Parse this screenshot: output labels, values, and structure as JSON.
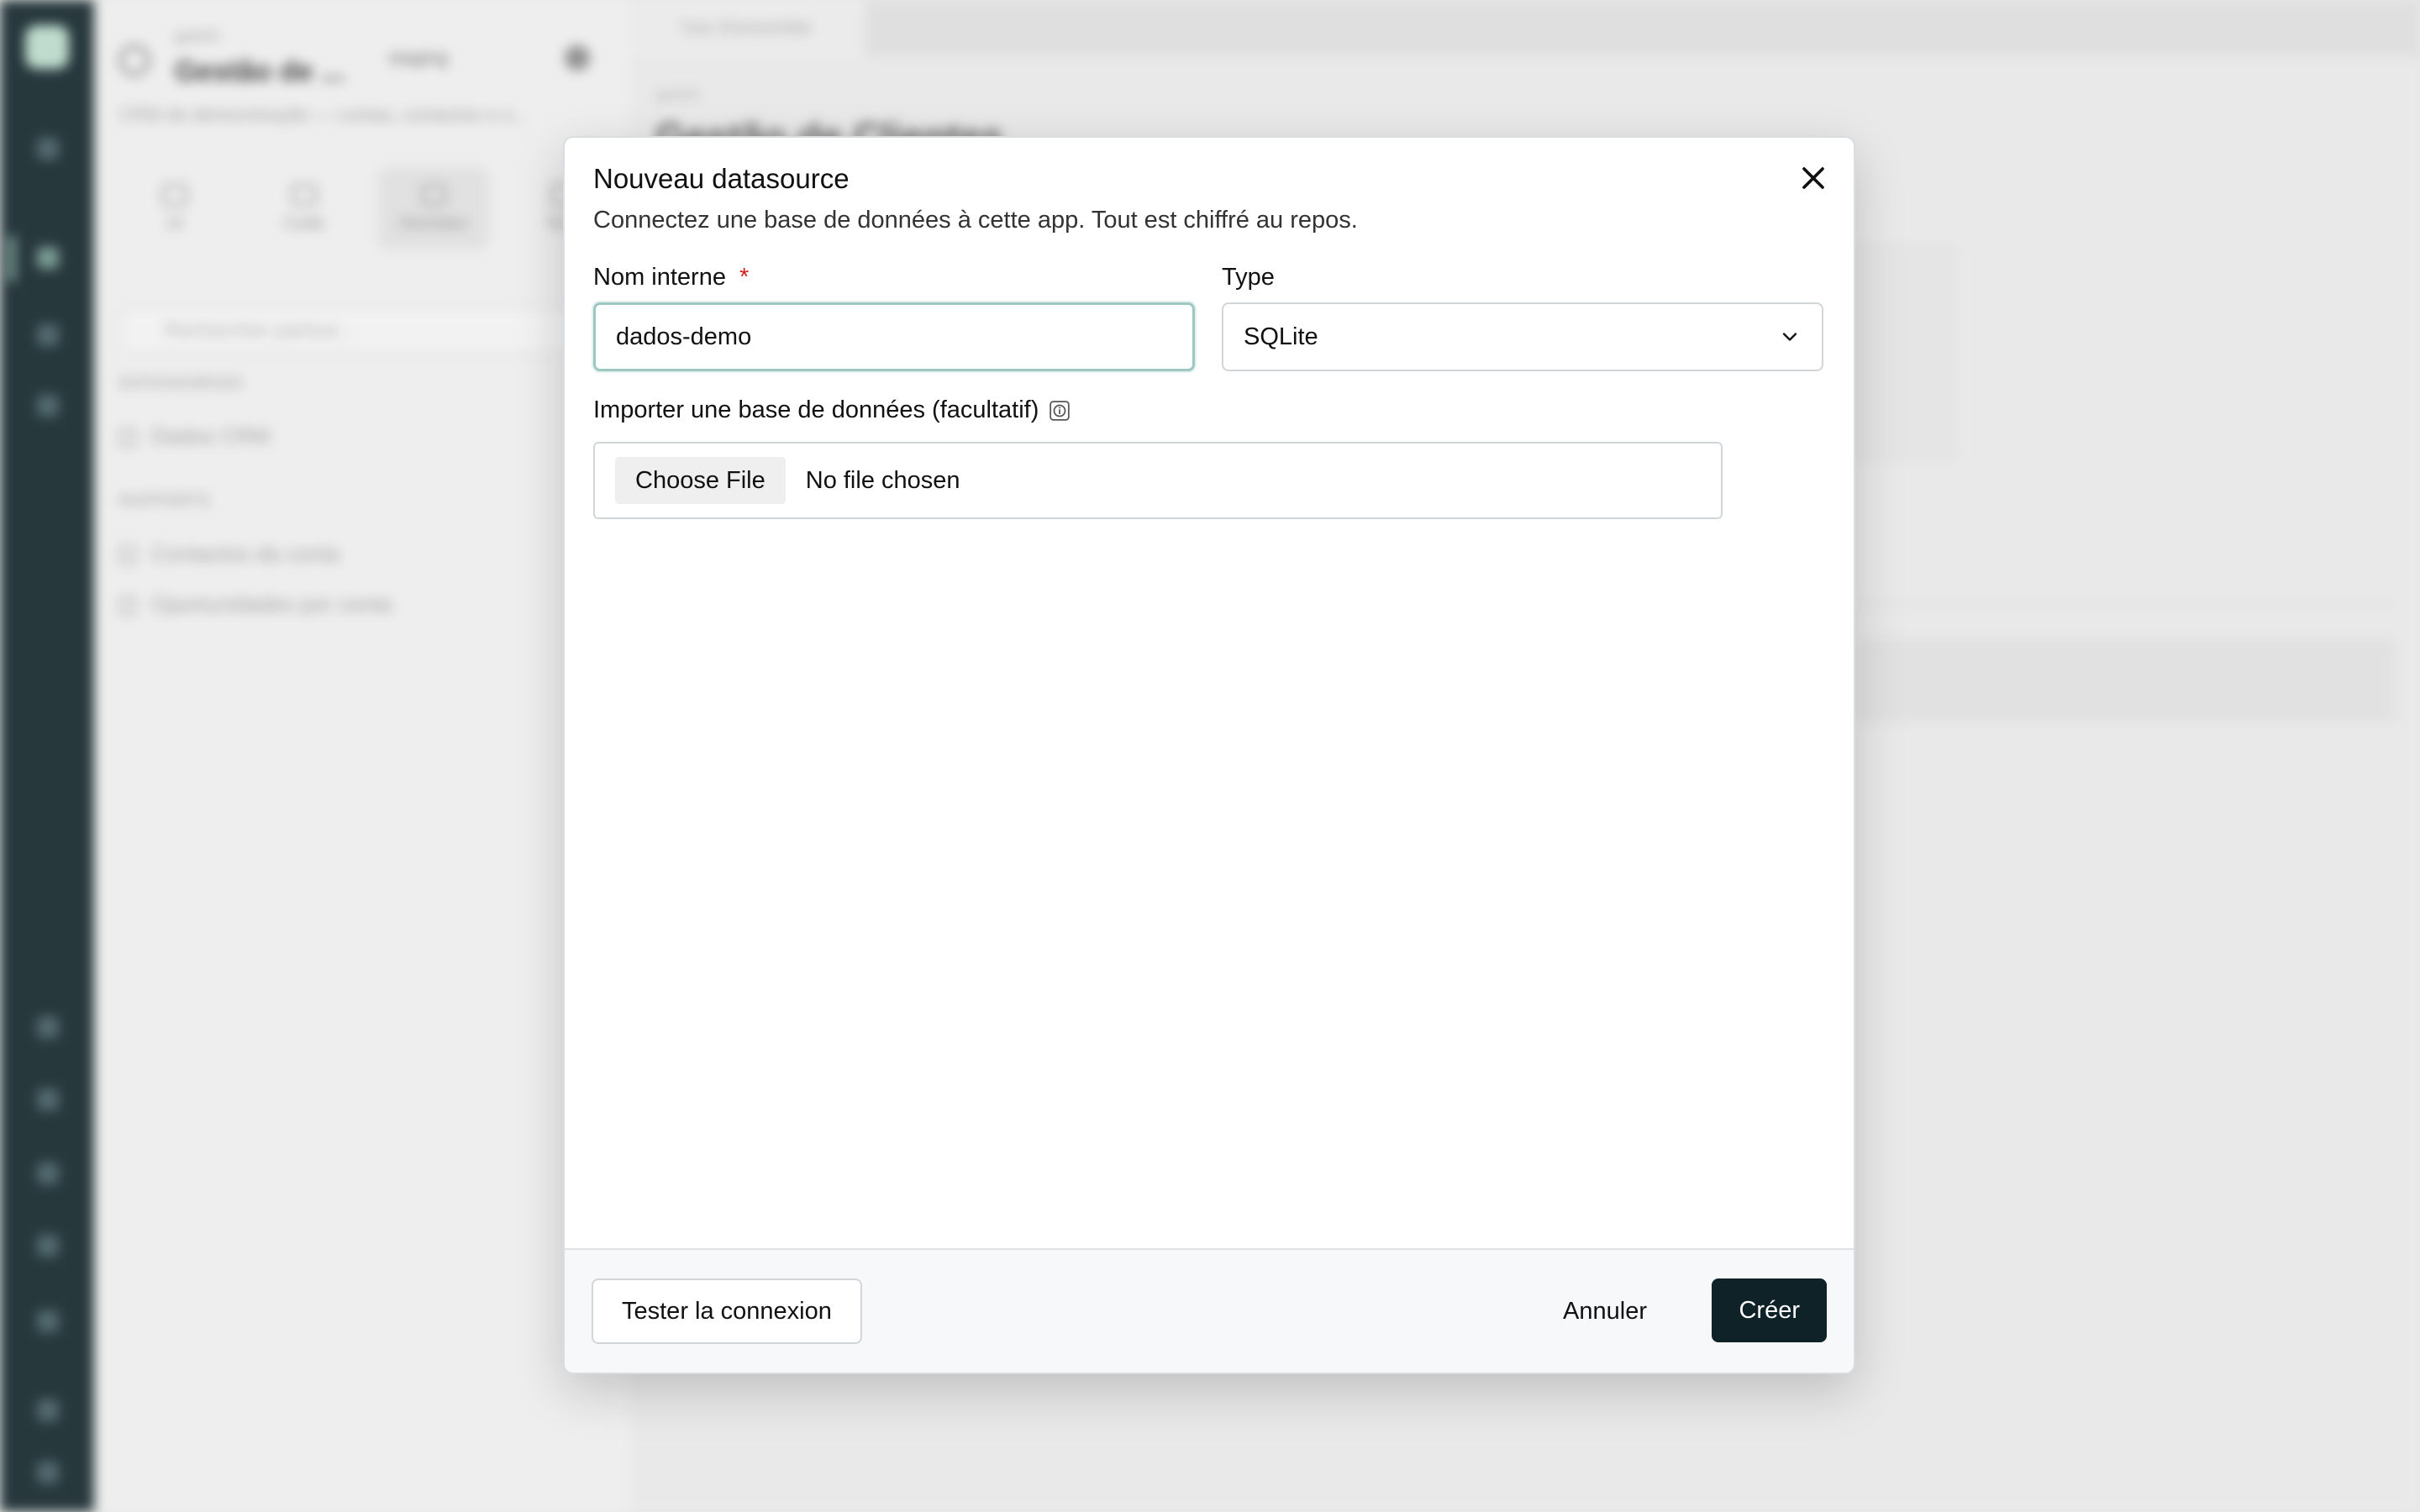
{
  "background": {
    "workspace": {
      "label": "guichi",
      "title": "Gestão de ...",
      "env": "staging",
      "description": "CRM de demonstração — contas, contactos e o..."
    },
    "tabs": [
      {
        "label": "UI"
      },
      {
        "label": "Code"
      },
      {
        "label": "Données"
      },
      {
        "label": "Run"
      }
    ],
    "search_placeholder": "Rechercher partout...",
    "sections": {
      "datasources": "DATASOURCES",
      "reports": "RAPPORTS"
    },
    "datasource_items": [
      "Dados CRM"
    ],
    "report_items": [
      "Contactos da conta",
      "Oportunidades por conta"
    ],
    "main_tab": "Vue d'ensemble",
    "breadcrumb": "guichi",
    "page_title": "Gestão de Clientes"
  },
  "modal": {
    "title": "Nouveau datasource",
    "subtitle": "Connectez une base de données à cette app. Tout est chiffré au repos.",
    "name_field": {
      "label": "Nom interne",
      "required_mark": "*",
      "value": "dados-demo"
    },
    "type_field": {
      "label": "Type",
      "value": "SQLite"
    },
    "import_field": {
      "label": "Importer une base de données (facultatif)",
      "button": "Choose File",
      "status": "No file chosen"
    },
    "footer": {
      "test": "Tester la connexion",
      "cancel": "Annuler",
      "create": "Créer"
    }
  },
  "colors": {
    "primary": "#0f2227",
    "required": "#d21f1f",
    "focus_border": "#9dc7c1"
  }
}
